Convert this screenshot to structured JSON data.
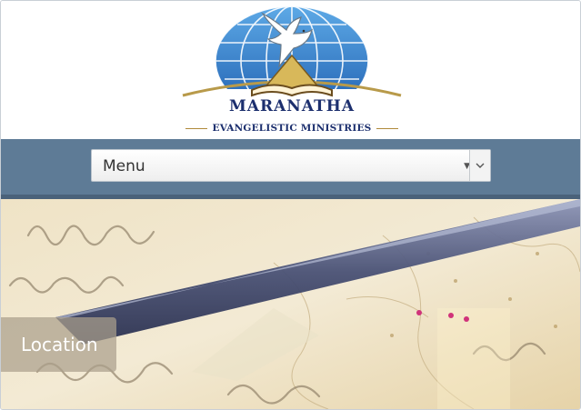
{
  "logo": {
    "name": "MARANATHA",
    "tagline": "EVANGELISTIC MINISTRIES"
  },
  "nav": {
    "menu_label": "Menu"
  },
  "hero": {
    "location_label": "Location"
  },
  "icons": {
    "logo": "dove-globe-bible-logo",
    "select_arrow": "chevron-down-icon"
  },
  "colors": {
    "navbar": "#5e7b96",
    "logo_text": "#1c2f6e",
    "location_box": "#aa9f8c"
  }
}
